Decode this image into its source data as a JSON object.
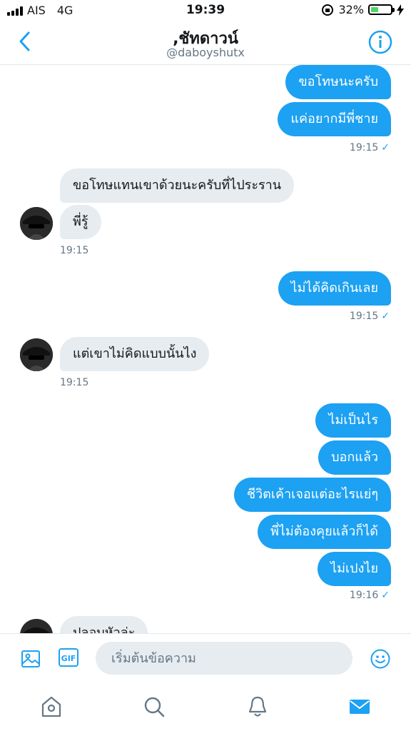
{
  "status_bar": {
    "carrier": "AIS",
    "network": "4G",
    "time": "19:39",
    "battery_text": "32%",
    "battery_level": 0.32
  },
  "header": {
    "title": ",ชัทดาวน์",
    "handle": "@daboyshutx",
    "accent": "#1da1f2"
  },
  "messages": [
    {
      "dir": "out",
      "text": "ขอโทษนะครับ"
    },
    {
      "dir": "out",
      "text": "แค่อยากมีพี่ชาย"
    },
    {
      "type": "time",
      "dir": "out",
      "text": "19:15",
      "read": "✓"
    },
    {
      "dir": "in",
      "text": "ขอโทษแทนเขาด้วยนะครับที่ไประราน"
    },
    {
      "dir": "in",
      "text": "พี่รู้"
    },
    {
      "type": "time",
      "dir": "in",
      "text": "19:15"
    },
    {
      "dir": "out",
      "text": "ไม่ได้คิดเกินเลย"
    },
    {
      "type": "time",
      "dir": "out",
      "text": "19:15",
      "read": "✓"
    },
    {
      "dir": "in",
      "text": "แต่เขาไม่คิดแบบนั้นไง"
    },
    {
      "type": "time",
      "dir": "in",
      "text": "19:15"
    },
    {
      "dir": "out",
      "text": "ไม่เป็นไร"
    },
    {
      "dir": "out",
      "text": "บอกแล้ว"
    },
    {
      "dir": "out",
      "text": "ชีวิตเค้าเจอแต่อะไรแย่ๆ"
    },
    {
      "dir": "out",
      "text": "พี่ไม่ต้องคุยแล้วก็ได้"
    },
    {
      "dir": "out",
      "text": "ไม่เปงไย"
    },
    {
      "type": "time",
      "dir": "out",
      "text": "19:16",
      "read": "✓"
    },
    {
      "dir": "in",
      "text": "ปลอบหัวล่ะ"
    }
  ],
  "composer": {
    "placeholder": "เริ่มต้นข้อความ",
    "gif_label": "GIF"
  },
  "tabs": [
    "home-icon",
    "search-icon",
    "notifications-icon",
    "messages-icon"
  ]
}
